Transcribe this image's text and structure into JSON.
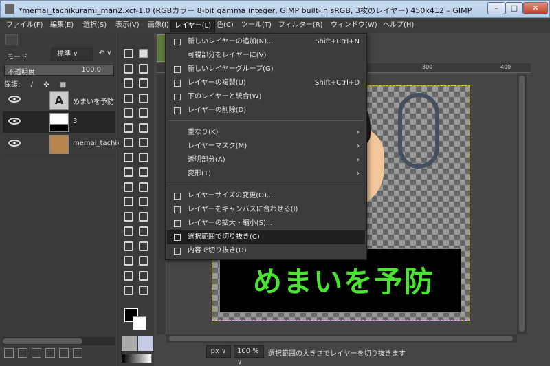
{
  "window": {
    "title": "*memai_tachikurami_man2.xcf-1.0 (RGBカラー 8-bit gamma integer, GIMP built-in sRGB, 3枚のレイヤー) 450x412 – GIMP",
    "min": "–",
    "max": "□",
    "close": "✕"
  },
  "menubar": [
    "ファイル(F)",
    "編集(E)",
    "選択(S)",
    "表示(V)",
    "画像(I)",
    "レイヤー(L)",
    "色(C)",
    "ツール(T)",
    "フィルター(R)",
    "ウィンドウ(W)",
    "ヘルプ(H)"
  ],
  "layers_panel": {
    "mode_label": "モード",
    "mode_value": "標準 ∨",
    "opacity_label": "不透明度",
    "opacity_value": "100.0",
    "opacity_fraction": 1.0,
    "lock_label": "保護:",
    "layers": [
      {
        "name": "めまいを予防",
        "thumb": "text"
      },
      {
        "name": "3",
        "thumb": "black"
      },
      {
        "name": "memai_tachik",
        "thumb": "image"
      }
    ]
  },
  "layer_menu": {
    "items": [
      {
        "label": "新しいレイヤーの追加(N)...",
        "shortcut": "Shift+Ctrl+N"
      },
      {
        "label": "可視部分をレイヤーに(V)",
        "shortcut": ""
      },
      {
        "label": "新しいレイヤーグループ(G)",
        "shortcut": ""
      },
      {
        "label": "レイヤーの複製(U)",
        "shortcut": "Shift+Ctrl+D"
      },
      {
        "label": "下のレイヤーと統合(W)",
        "shortcut": ""
      },
      {
        "label": "レイヤーの削除(D)",
        "shortcut": ""
      },
      {
        "label": "重なり(K)",
        "submenu": "›"
      },
      {
        "label": "レイヤーマスク(M)",
        "submenu": "›"
      },
      {
        "label": "透明部分(A)",
        "submenu": "›"
      },
      {
        "label": "変形(T)",
        "submenu": "›"
      },
      {
        "label": "レイヤーサイズの変更(O)...",
        "shortcut": ""
      },
      {
        "label": "レイヤーをキャンバスに合わせる(I)",
        "shortcut": ""
      },
      {
        "label": "レイヤーの拡大・縮小(S)...",
        "shortcut": ""
      },
      {
        "label": "選択範囲で切り抜き(C)",
        "shortcut": "",
        "highlighted": true
      },
      {
        "label": "内容で切り抜き(O)",
        "shortcut": ""
      }
    ]
  },
  "ruler": {
    "labels": [
      "300",
      "400"
    ]
  },
  "canvas": {
    "banner_text": "めまいを予防",
    "banner_color": "#4be531"
  },
  "statusbar": {
    "unit": "px ∨",
    "zoom": "100 % ∨",
    "message": "選択範囲の大きさでレイヤーを切り抜きます"
  },
  "icons": {
    "eye": "eye-icon",
    "lock-pixels": "pencil-lock-icon",
    "lock-position": "cross-arrows-icon",
    "lock-alpha": "checker-icon",
    "mode-reset": "undo-icon"
  }
}
